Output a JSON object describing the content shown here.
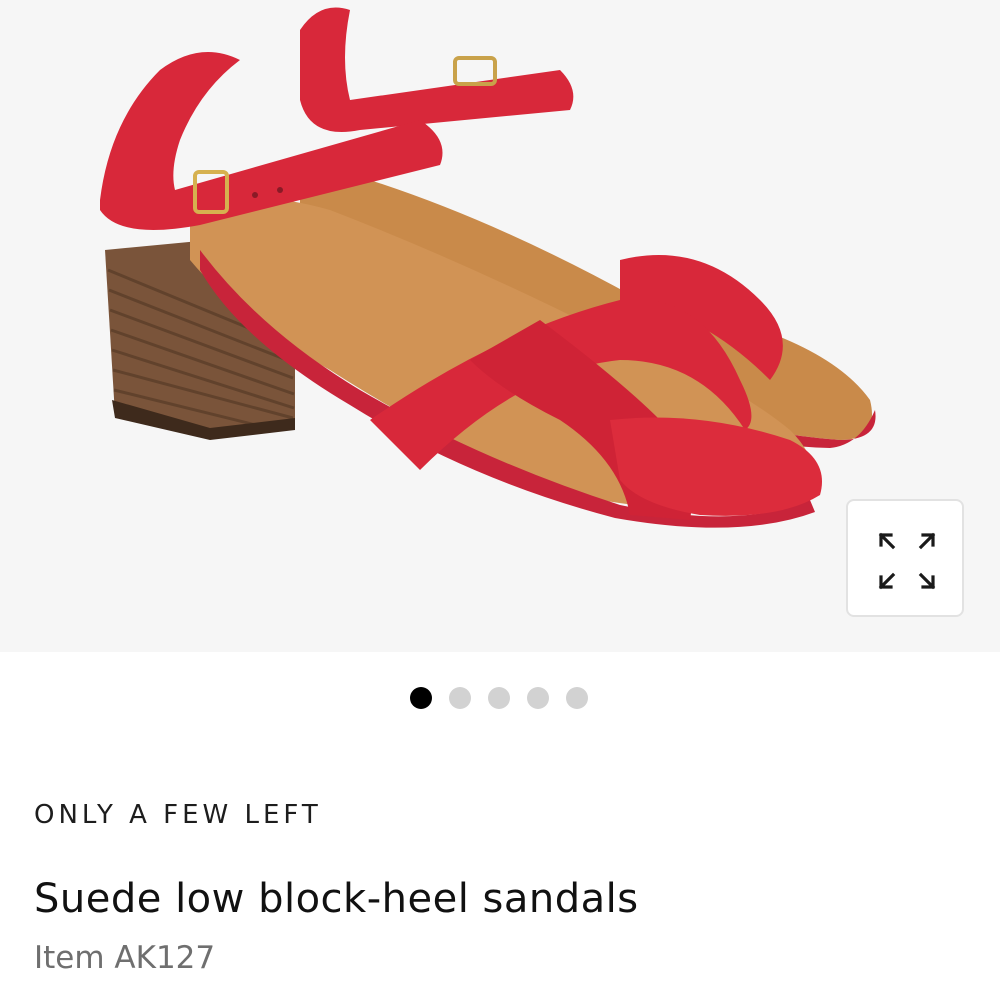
{
  "product": {
    "image_alt": "Red suede sandals with block heel",
    "stock_label": "ONLY A FEW LEFT",
    "title": "Suede low block-heel sandals",
    "item_number": "Item AK127",
    "color": "#d8283a"
  },
  "gallery": {
    "image_count": 5,
    "active_index": 0,
    "expand_icon": "expand-arrows-icon"
  }
}
